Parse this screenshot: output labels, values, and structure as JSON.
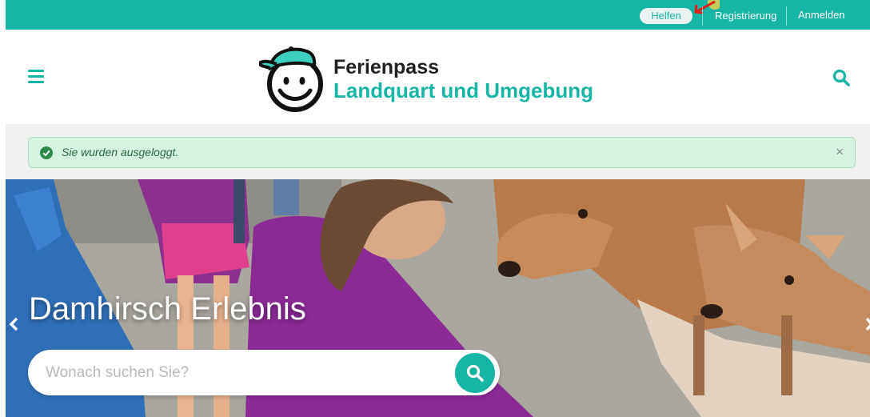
{
  "topbar": {
    "help_label": "Helfen",
    "register_label": "Registrierung",
    "login_label": "Anmelden"
  },
  "header": {
    "brand_line1": "Ferienpass",
    "brand_line2": "Landquart und Umgebung"
  },
  "alert": {
    "message": "Sie wurden ausgeloggt.",
    "close_symbol": "×"
  },
  "hero": {
    "title": "Damhirsch Erlebnis",
    "search_placeholder": "Wonach suchen Sie?"
  },
  "colors": {
    "accent": "#17b5a5",
    "alert_bg": "#d6f2e0",
    "alert_text": "#2c6a3e"
  },
  "icons": [
    "menu-icon",
    "search-icon",
    "check-circle-icon",
    "close-icon",
    "chevron-left-icon",
    "chevron-right-icon",
    "arrow-icon",
    "logo-smiley-icon"
  ]
}
